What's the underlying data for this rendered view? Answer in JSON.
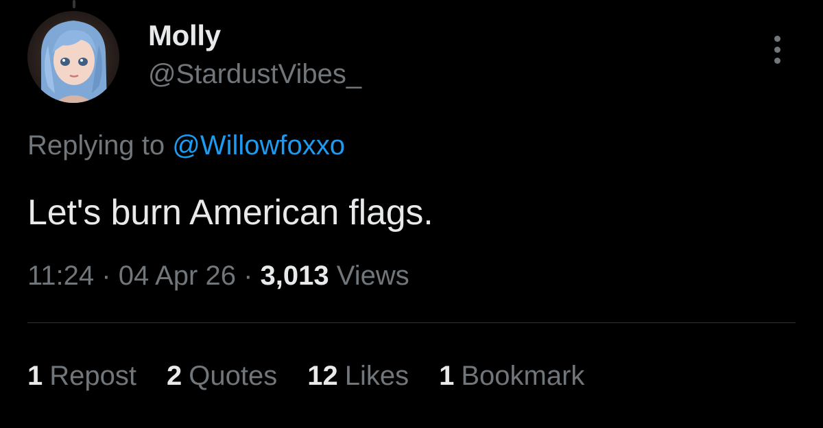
{
  "author": {
    "display_name": "Molly",
    "handle": "@StardustVibes_",
    "avatar_icon": "anime-girl-avatar"
  },
  "reply": {
    "prefix": "Replying to",
    "mention": "@Willowfoxxo"
  },
  "tweet": {
    "text": "Let's burn American flags."
  },
  "meta": {
    "time": "11:24",
    "separator": "·",
    "date": "04 Apr 26",
    "views_count": "3,013",
    "views_label": "Views"
  },
  "stats": [
    {
      "count": "1",
      "label": "Repost"
    },
    {
      "count": "2",
      "label": "Quotes"
    },
    {
      "count": "12",
      "label": "Likes"
    },
    {
      "count": "1",
      "label": "Bookmark"
    }
  ],
  "colors": {
    "background": "#000000",
    "primary_text": "#e7e9ea",
    "secondary_text": "#71767b",
    "link": "#1d9bf0",
    "divider": "#2f3336"
  }
}
